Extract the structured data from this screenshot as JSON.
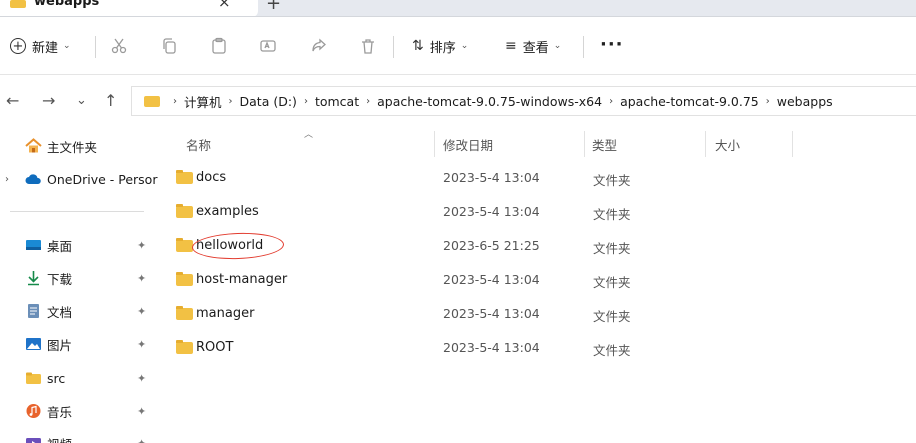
{
  "tabs": [
    {
      "title": "webapps",
      "close": "×"
    }
  ],
  "new_tab_symbol": "+",
  "toolbar": {
    "new_label": "新建",
    "sort_label": "排序",
    "view_label": "查看",
    "more": "···",
    "caret": "⌄"
  },
  "nav": {
    "back": "←",
    "forward": "→",
    "recent": "⌄",
    "up": "↑"
  },
  "breadcrumbs": [
    "计算机",
    "Data (D:)",
    "tomcat",
    "apache-tomcat-9.0.75-windows-x64",
    "apache-tomcat-9.0.75",
    "webapps"
  ],
  "sidebar": {
    "items": [
      {
        "label": "主文件夹",
        "icon": "home-icon",
        "pinned": false
      },
      {
        "label": "OneDrive - Persor",
        "icon": "cloud-icon",
        "pinned": false,
        "expander": "›"
      },
      {
        "label": "桌面",
        "icon": "desktop-icon",
        "pinned": true
      },
      {
        "label": "下载",
        "icon": "download-icon",
        "pinned": true
      },
      {
        "label": "文档",
        "icon": "document-icon",
        "pinned": true
      },
      {
        "label": "图片",
        "icon": "pictures-icon",
        "pinned": true
      },
      {
        "label": "src",
        "icon": "folder-icon",
        "pinned": true
      },
      {
        "label": "音乐",
        "icon": "music-icon",
        "pinned": true
      },
      {
        "label": "视频",
        "icon": "video-icon",
        "pinned": true
      }
    ],
    "pin_symbol": "📌"
  },
  "columns": {
    "name": "名称",
    "modified": "修改日期",
    "type": "类型",
    "size": "大小"
  },
  "files": [
    {
      "name": "docs",
      "modified": "2023-5-4 13:04",
      "type": "文件夹",
      "size": ""
    },
    {
      "name": "examples",
      "modified": "2023-5-4 13:04",
      "type": "文件夹",
      "size": ""
    },
    {
      "name": "helloworld",
      "modified": "2023-6-5 21:25",
      "type": "文件夹",
      "size": "",
      "circled": true
    },
    {
      "name": "host-manager",
      "modified": "2023-5-4 13:04",
      "type": "文件夹",
      "size": ""
    },
    {
      "name": "manager",
      "modified": "2023-5-4 13:04",
      "type": "文件夹",
      "size": ""
    },
    {
      "name": "ROOT",
      "modified": "2023-5-4 13:04",
      "type": "文件夹",
      "size": ""
    }
  ],
  "colors": {
    "folder": "#f2c144",
    "annotation": "#e23b2e",
    "accent": "#0067c0"
  }
}
